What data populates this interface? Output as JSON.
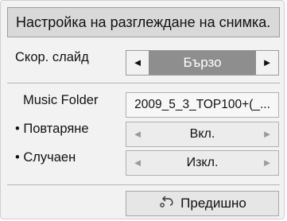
{
  "dialog": {
    "title": "Настройка на разглеждане на снимка."
  },
  "slide_speed": {
    "label": "Скор. слайд",
    "value": "Бързо",
    "left_arrow": "◄",
    "right_arrow": "►"
  },
  "music_folder": {
    "label": "Music Folder",
    "value": "2009_5_3_TOP100+(_..."
  },
  "repeat": {
    "label": "• Повтаряне",
    "value": "Вкл.",
    "left_arrow": "◄",
    "right_arrow": "►"
  },
  "random": {
    "label": "• Случаен",
    "value": "Изкл.",
    "left_arrow": "◄",
    "right_arrow": "►"
  },
  "back_button": {
    "label": "Предишно",
    "icon": "back-arrow-icon"
  }
}
